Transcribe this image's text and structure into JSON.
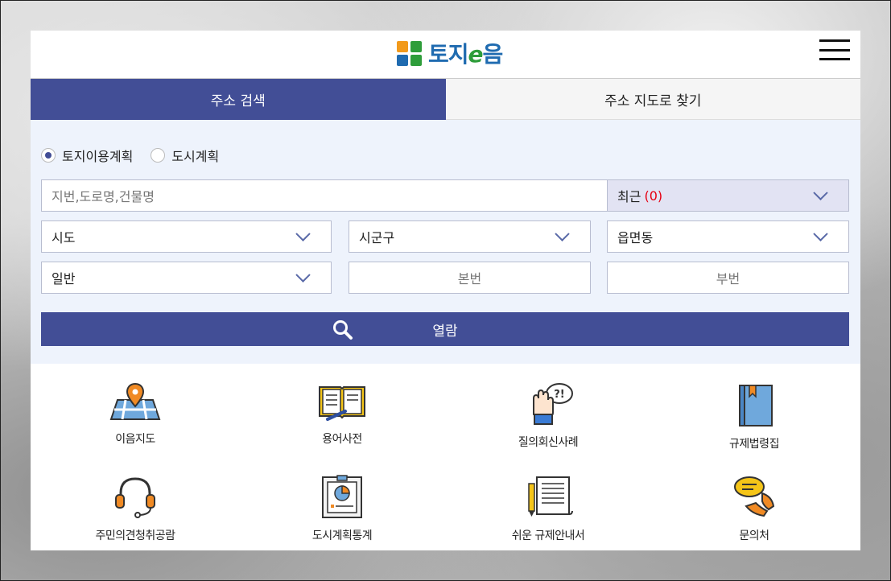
{
  "header": {
    "logo_text_1": "토지",
    "logo_text_e": "e",
    "logo_text_2": "음"
  },
  "tabs": [
    {
      "label": "주소 검색",
      "active": true
    },
    {
      "label": "주소 지도로 찾기",
      "active": false
    }
  ],
  "search": {
    "radios": [
      {
        "label": "토지이용계획",
        "checked": true
      },
      {
        "label": "도시계획",
        "checked": false
      }
    ],
    "address_placeholder": "지번,도로명,건물명",
    "recent_label": "최근",
    "recent_count": "(0)",
    "sido": "시도",
    "sigungu": "시군구",
    "eupmyeondong": "읍면동",
    "lot_type": "일반",
    "main_number_placeholder": "본번",
    "sub_number_placeholder": "부번",
    "view_button": "열람"
  },
  "menu": [
    {
      "label": "이음지도",
      "icon": "map-pin-icon"
    },
    {
      "label": "용어사전",
      "icon": "open-book-icon"
    },
    {
      "label": "질의회신사례",
      "icon": "raised-hand-question-icon"
    },
    {
      "label": "규제법령집",
      "icon": "law-book-icon"
    },
    {
      "label": "주민의견청취공람",
      "icon": "headset-icon"
    },
    {
      "label": "도시계획통계",
      "icon": "chart-clipboard-icon"
    },
    {
      "label": "쉬운 규제안내서",
      "icon": "document-pencil-icon"
    },
    {
      "label": "문의처",
      "icon": "phone-chat-icon"
    }
  ],
  "colors": {
    "primary": "#424e96",
    "accent_red": "#e60012",
    "search_bg": "#eef3fc"
  }
}
